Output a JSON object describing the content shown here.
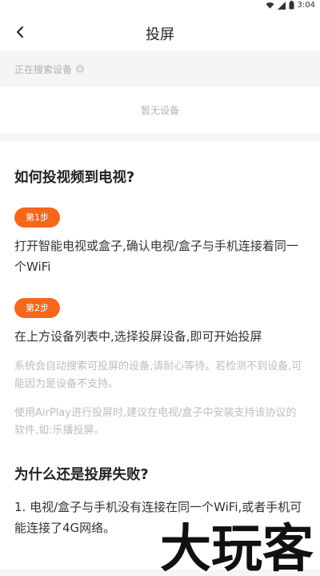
{
  "status": {
    "time": "3:04"
  },
  "header": {
    "title": "投屏"
  },
  "search": {
    "status_text": "正在搜索设备"
  },
  "devices": {
    "empty_text": "暂无设备"
  },
  "guide": {
    "heading": "如何投视频到电视?",
    "step1_badge": "第1步",
    "step1_text": "打开智能电视或盒子,确认电视/盒子与手机连接着同一个WiFi",
    "step2_badge": "第2步",
    "step2_text": "在上方设备列表中,选择投屏设备,即可开始投屏",
    "tip1": "系统会自动搜索可投屏的设备,请耐心等待。若检测不到设备,可能因为是设备不支持。",
    "tip2": "使用AirPlay进行投屏时,建议在电视/盒子中安装支持该协议的软件,如:乐播投屏。"
  },
  "faq": {
    "heading": "为什么还是投屏失败?",
    "item1": "1. 电视/盒子与手机没有连接在同一个WiFi,或者手机可能连接了4G网络。"
  },
  "watermark": {
    "text": "大玩客"
  },
  "colors": {
    "accent": "#f5681c",
    "muted": "#bdbdbd"
  }
}
